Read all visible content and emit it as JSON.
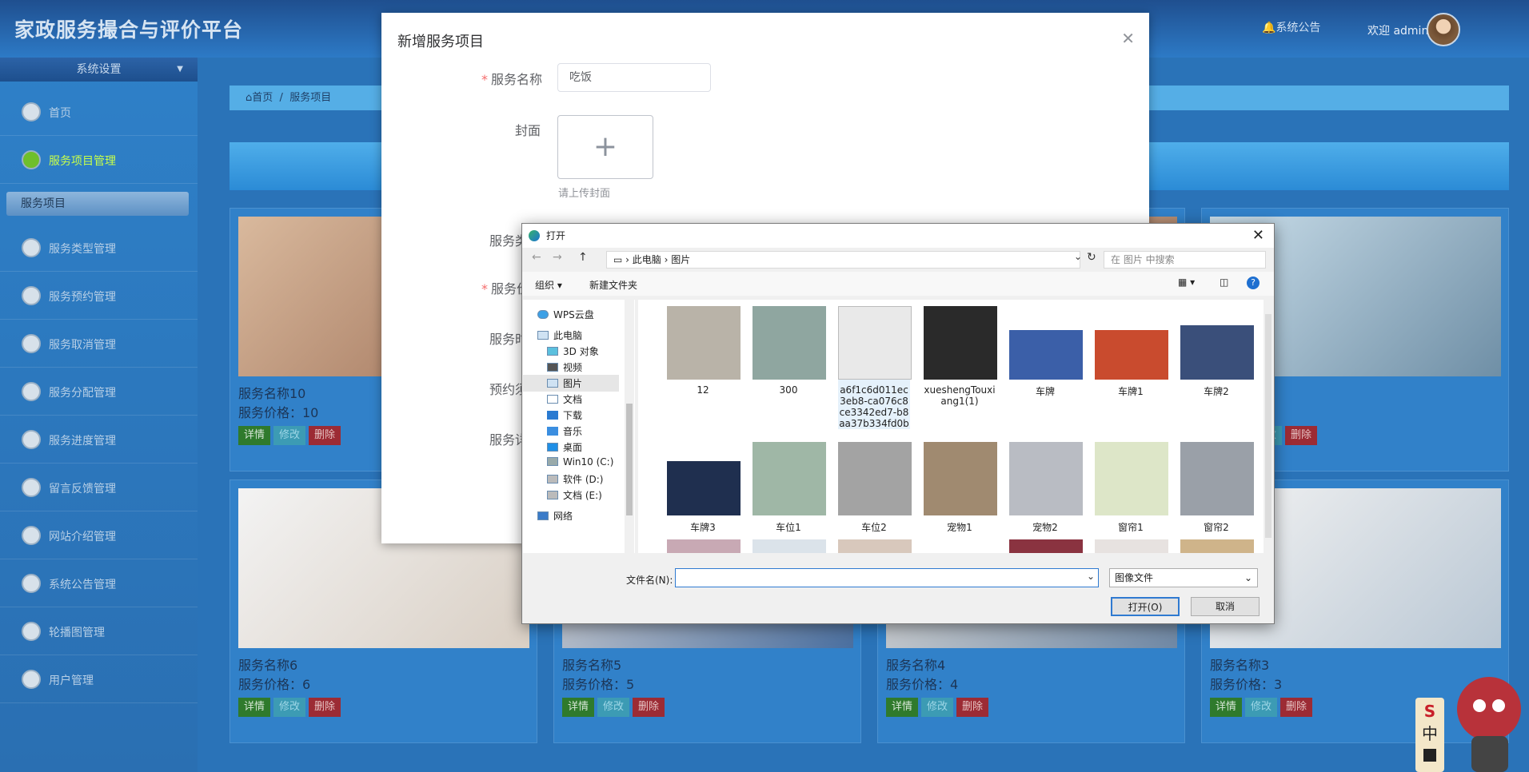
{
  "header": {
    "brand": "家政服务撮合与评价平台",
    "notice": "系统公告",
    "welcome": "欢迎 admin"
  },
  "sidebar": {
    "section": "系统设置",
    "items": [
      {
        "label": "首页"
      },
      {
        "label": "服务项目管理"
      },
      {
        "label": "服务类型管理"
      },
      {
        "label": "服务预约管理"
      },
      {
        "label": "服务取消管理"
      },
      {
        "label": "服务分配管理"
      },
      {
        "label": "服务进度管理"
      },
      {
        "label": "留言反馈管理"
      },
      {
        "label": "网站介绍管理"
      },
      {
        "label": "系统公告管理"
      },
      {
        "label": "轮播图管理"
      },
      {
        "label": "用户管理"
      }
    ],
    "sub": "服务项目"
  },
  "breadcrumb": {
    "home": "首页",
    "current": "服务项目"
  },
  "cards": [
    {
      "name": "服务名称10",
      "price": "服务价格：10"
    },
    {
      "name": "",
      "price": ""
    },
    {
      "name": "",
      "price": ""
    },
    {
      "name": "7",
      "price": ""
    },
    {
      "name": "服务名称6",
      "price": "服务价格：6"
    },
    {
      "name": "服务名称5",
      "price": "服务价格：5"
    },
    {
      "name": "服务名称4",
      "price": "服务价格：4"
    },
    {
      "name": "服务名称3",
      "price": "服务价格：3"
    }
  ],
  "card_buttons": {
    "detail": "详情",
    "edit": "修改",
    "delete": "删除"
  },
  "dialog": {
    "title": "新增服务项目",
    "name_label": "服务名称",
    "name_value": "吃饭",
    "cover_label": "封面",
    "cover_tip": "请上传封面",
    "labels": [
      "服务类",
      "服务价",
      "服务时",
      "预约须",
      "服务详"
    ]
  },
  "file_dialog": {
    "title": "打开",
    "path": [
      "此电脑",
      "图片"
    ],
    "search_placeholder": "在 图片 中搜索",
    "organize": "组织 ▾",
    "new_folder": "新建文件夹",
    "tree": [
      "WPS云盘",
      "此电脑",
      "3D 对象",
      "视频",
      "图片",
      "文档",
      "下载",
      "音乐",
      "桌面",
      "Win10 (C:)",
      "软件 (D:)",
      "文档 (E:)",
      "网络"
    ],
    "files": [
      {
        "name": "12",
        "color": "#b9b3a8"
      },
      {
        "name": "300",
        "color": "#8fa6a0"
      },
      {
        "name": "a6f1c6d011ec3eb8-ca076c8ce3342ed7-b8aa37b334fd0b1b...",
        "color": "#e9e9e9"
      },
      {
        "name": "xueshengTouxiang1(1)",
        "color": "#2a2a2a"
      },
      {
        "name": "车牌",
        "color": "#3b5fa8"
      },
      {
        "name": "车牌1",
        "color": "#c94b2e"
      },
      {
        "name": "车牌2",
        "color": "#3a4f7a"
      },
      {
        "name": "车牌3",
        "color": "#1f2f4f"
      },
      {
        "name": "车位1",
        "color": "#9fb7a6"
      },
      {
        "name": "车位2",
        "color": "#a3a3a3"
      },
      {
        "name": "宠物1",
        "color": "#a08a70"
      },
      {
        "name": "宠物2",
        "color": "#b9bcc3"
      },
      {
        "name": "窗帘1",
        "color": "#dde6c8"
      },
      {
        "name": "窗帘2",
        "color": "#9aa0a8"
      }
    ],
    "filename_label": "文件名(N):",
    "filetype": "图像文件",
    "open": "打开(O)",
    "cancel": "取消"
  }
}
